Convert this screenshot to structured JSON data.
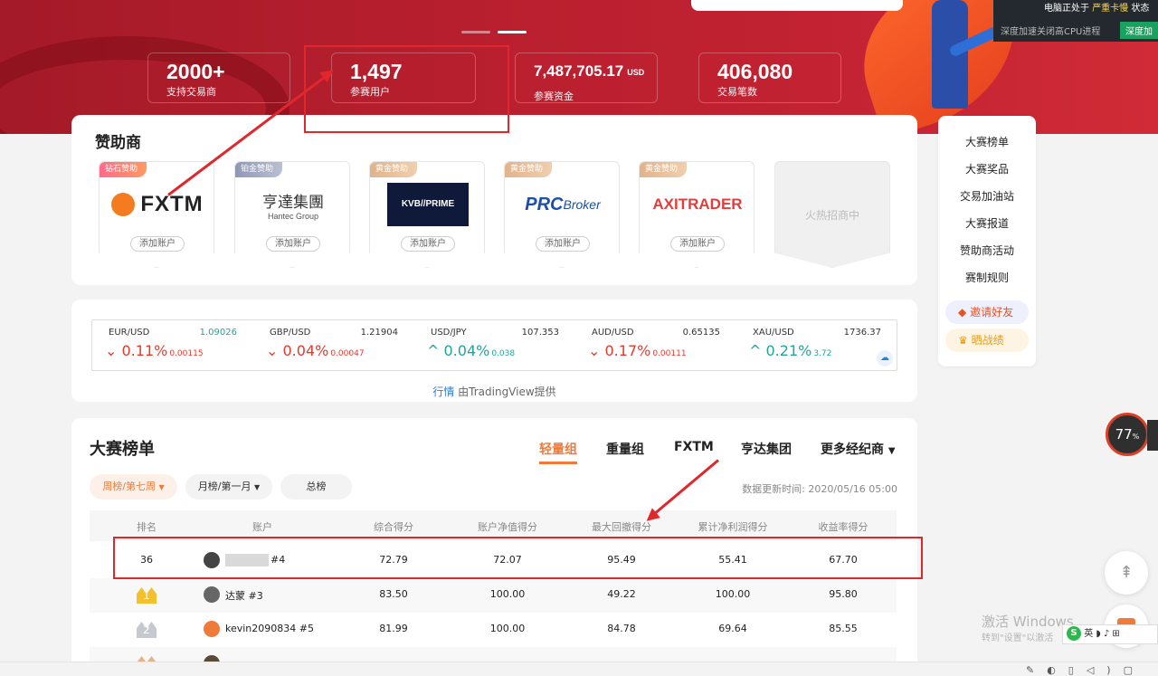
{
  "hero": {
    "stats": [
      {
        "value": "2000+",
        "unit": "",
        "label": "支持交易商"
      },
      {
        "value": "1,497",
        "unit": "",
        "label": "参赛用户"
      },
      {
        "value": "7,487,705.17",
        "unit": "USD",
        "label": "参赛资金"
      },
      {
        "value": "406,080",
        "unit": "",
        "label": "交易笔数"
      }
    ]
  },
  "system_overlay": {
    "line1_prefix": "电脑正处于",
    "line1_status": "严重卡慢",
    "line1_suffix": "状态",
    "line2": "深度加速关闭高CPU进程",
    "button": "深度加"
  },
  "sponsors": {
    "title": "赞助商",
    "add_account_label": "添加账户",
    "cards": [
      {
        "tag": "钻石赞助",
        "logo": "FXTM"
      },
      {
        "tag": "铂金赞助",
        "logo": "亨達集團",
        "logo_sub": "Hantec Group"
      },
      {
        "tag": "黄金赞助",
        "logo": "KVB//PRIME"
      },
      {
        "tag": "黄金赞助",
        "logo": "PRC",
        "logo_sub": "Broker"
      },
      {
        "tag": "黄金赞助",
        "logo": "AXITRADER"
      }
    ],
    "empty_slot": "火热招商中"
  },
  "ticker": {
    "items": [
      {
        "symbol": "EUR/USD",
        "price": "1.09026",
        "direction": "down",
        "change_pct": "0.11%",
        "change_abs": "0.00115"
      },
      {
        "symbol": "GBP/USD",
        "price": "1.21904",
        "direction": "down",
        "change_pct": "0.04%",
        "change_abs": "0.00047"
      },
      {
        "symbol": "USD/JPY",
        "price": "107.353",
        "direction": "up",
        "change_pct": "0.04%",
        "change_abs": "0.038"
      },
      {
        "symbol": "AUD/USD",
        "price": "0.65135",
        "direction": "down",
        "change_pct": "0.17%",
        "change_abs": "0.00111"
      },
      {
        "symbol": "XAU/USD",
        "price": "1736.37",
        "direction": "up",
        "change_pct": "0.21%",
        "change_abs": "3.72"
      }
    ],
    "footer_link": "行情",
    "footer_text": "由TradingView提供"
  },
  "side_nav": {
    "items": [
      "大赛榜单",
      "大赛奖品",
      "交易加油站",
      "大赛报道",
      "赞助商活动",
      "赛制规则"
    ],
    "invite": "邀请好友",
    "battle": "晒战绩"
  },
  "leaderboard": {
    "title": "大赛榜单",
    "tabs": [
      "轻量组",
      "重量组",
      "FXTM",
      "亨达集团",
      "更多经纪商"
    ],
    "filters": {
      "week": "周榜/第七周",
      "month": "月榜/第一月",
      "total": "总榜"
    },
    "updated": "数据更新时间: 2020/05/16 05:00",
    "columns": [
      "排名",
      "账户",
      "综合得分",
      "账户净值得分",
      "最大回撤得分",
      "累计净利润得分",
      "收益率得分"
    ],
    "rows": [
      {
        "rank": "36",
        "account": "#4",
        "composite": "72.79",
        "equity": "72.07",
        "drawdown": "95.49",
        "profit": "55.41",
        "return": "67.70"
      },
      {
        "rank": "1",
        "account": "达蒙 #3",
        "composite": "83.50",
        "equity": "100.00",
        "drawdown": "49.22",
        "profit": "100.00",
        "return": "95.80"
      },
      {
        "rank": "2",
        "account": "kevin2090834 #5",
        "composite": "81.99",
        "equity": "100.00",
        "drawdown": "84.78",
        "profit": "69.64",
        "return": "85.55"
      }
    ]
  },
  "floaters": {
    "gauge_value": "77",
    "gauge_unit": "%",
    "watermark_title": "激活 Windows",
    "watermark_sub": "转到\"设置\"以激活",
    "tray_ime": "英"
  },
  "colors": {
    "brand_red": "#b81f2e",
    "accent_orange": "#f07a3a",
    "down": "#e5392b",
    "up": "#1ea69a",
    "annotation": "#e0272b"
  }
}
